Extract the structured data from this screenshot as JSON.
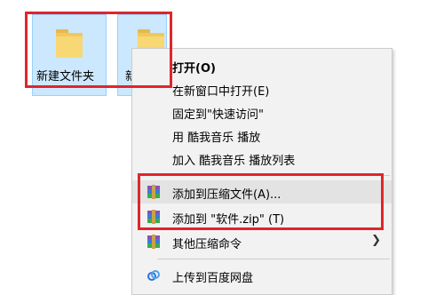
{
  "desktop": {
    "folders": [
      {
        "label": "新建文件夹"
      },
      {
        "label": "新"
      }
    ]
  },
  "context_menu": {
    "items": [
      {
        "label": "打开(O)",
        "bold": true
      },
      {
        "label": "在新窗口中打开(E)"
      },
      {
        "label": "固定到\"快速访问\""
      },
      {
        "label": "用 酷我音乐 播放"
      },
      {
        "label": "加入 酷我音乐 播放列表"
      },
      {
        "label": "添加到压缩文件(A)...",
        "icon": "winrar-icon"
      },
      {
        "label": "添加到 \"软件.zip\" (T)",
        "icon": "winrar-icon"
      },
      {
        "label": "其他压缩命令",
        "icon": "winrar-icon",
        "has_submenu": true
      },
      {
        "label": "上传到百度网盘",
        "icon": "baidu-netdisk-icon"
      }
    ]
  },
  "colors": {
    "highlight_red": "#e0252b",
    "folder_selection": "#cce8ff",
    "menu_background": "#f2f2f2",
    "folder_yellow": "#f8d775"
  }
}
